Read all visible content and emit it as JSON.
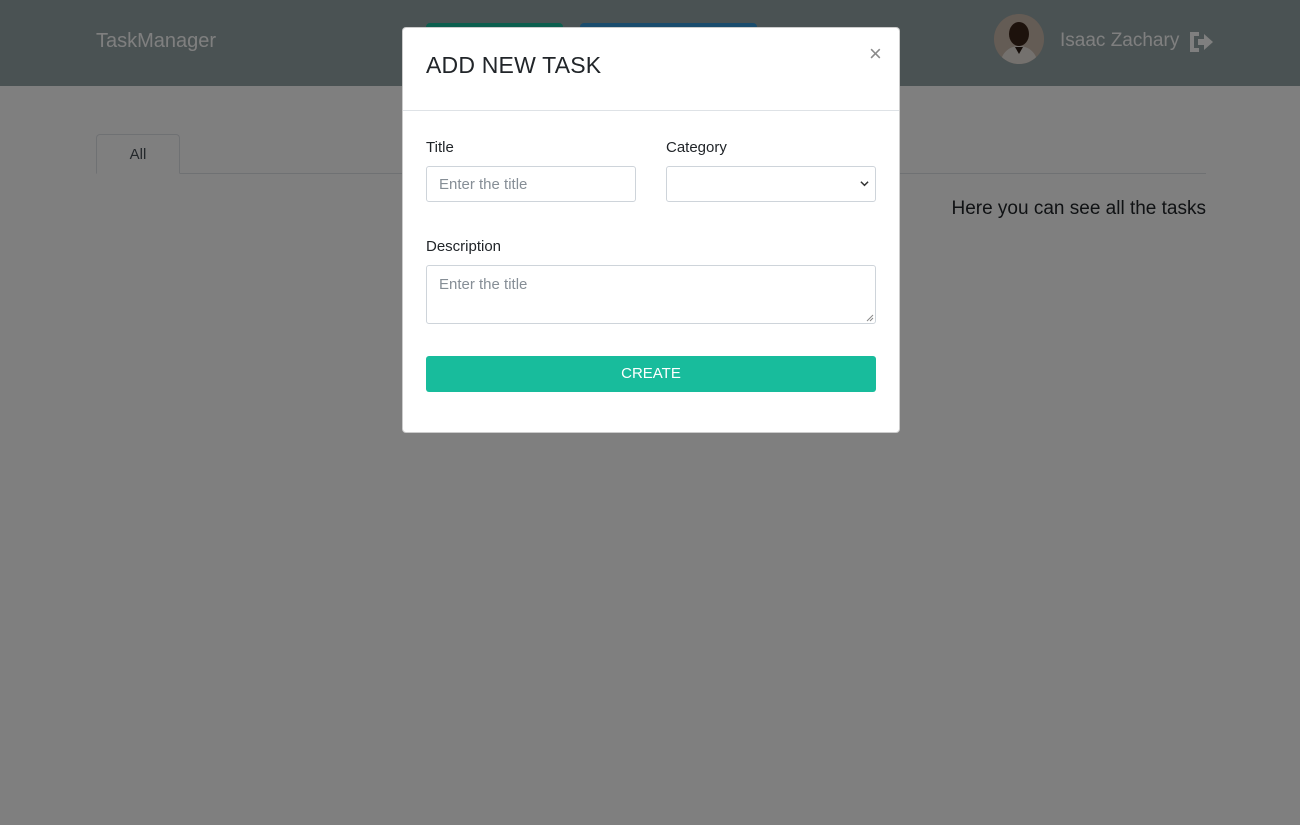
{
  "navbar": {
    "brand": "TaskManager",
    "user_name": "Isaac Zachary",
    "avatar_icon": "user-avatar",
    "logout_icon": "logout-icon",
    "color": "#95a5a6"
  },
  "tabs": [
    {
      "label": "All",
      "active": true
    }
  ],
  "main": {
    "info_text": "Here you can see all the tasks"
  },
  "modal": {
    "title": "ADD NEW TASK",
    "close_symbol": "×",
    "fields": {
      "title": {
        "label": "Title",
        "placeholder": "Enter the title",
        "value": ""
      },
      "category": {
        "label": "Category",
        "selected": ""
      },
      "description": {
        "label": "Description",
        "placeholder": "Enter the title",
        "value": ""
      }
    },
    "create_label": "CREATE"
  },
  "colors": {
    "accent": "#18bc9c",
    "secondary": "#3498db",
    "backdrop": "rgba(0,0,0,0.5)"
  }
}
